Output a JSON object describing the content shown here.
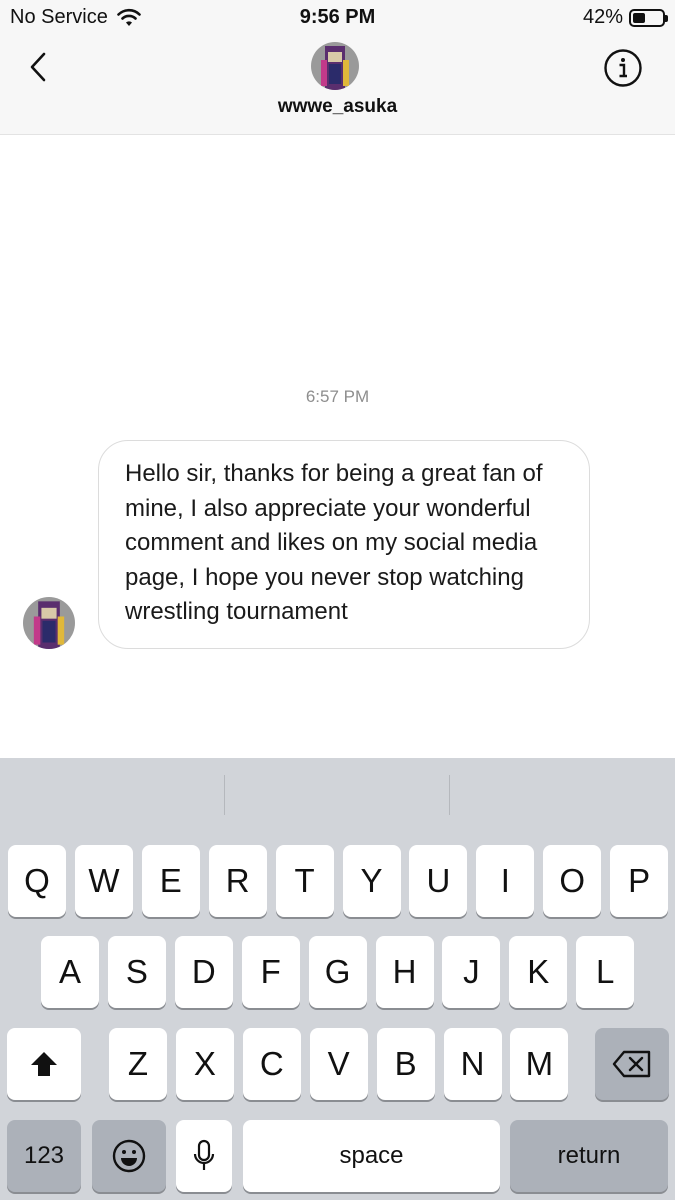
{
  "status_bar": {
    "carrier": "No Service",
    "time": "9:56 PM",
    "battery_percent": "42%",
    "battery_level": 0.42
  },
  "header": {
    "username": "wwwe_asuka",
    "back_icon": "chevron-left-icon",
    "info_icon": "info-icon"
  },
  "chat": {
    "timestamp": "6:57 PM",
    "message": "Hello sir, thanks for being a great fan of mine, I also appreciate your wonderful comment and likes on my social media page, I hope you never stop watching wrestling tournament"
  },
  "keyboard": {
    "row1": [
      "Q",
      "W",
      "E",
      "R",
      "T",
      "Y",
      "U",
      "I",
      "O",
      "P"
    ],
    "row2": [
      "A",
      "S",
      "D",
      "F",
      "G",
      "H",
      "J",
      "K",
      "L"
    ],
    "row3": [
      "Z",
      "X",
      "C",
      "V",
      "B",
      "N",
      "M"
    ],
    "numbers_label": "123",
    "space_label": "space",
    "return_label": "return",
    "shift_icon": "shift-icon",
    "delete_icon": "delete-icon",
    "emoji_icon": "emoji-icon",
    "mic_icon": "microphone-icon"
  },
  "colors": {
    "keyboard_bg": "#d1d4d9",
    "key_bg": "#ffffff",
    "dark_key_bg": "#acb1b9",
    "timestamp_color": "#8e8e8e"
  }
}
